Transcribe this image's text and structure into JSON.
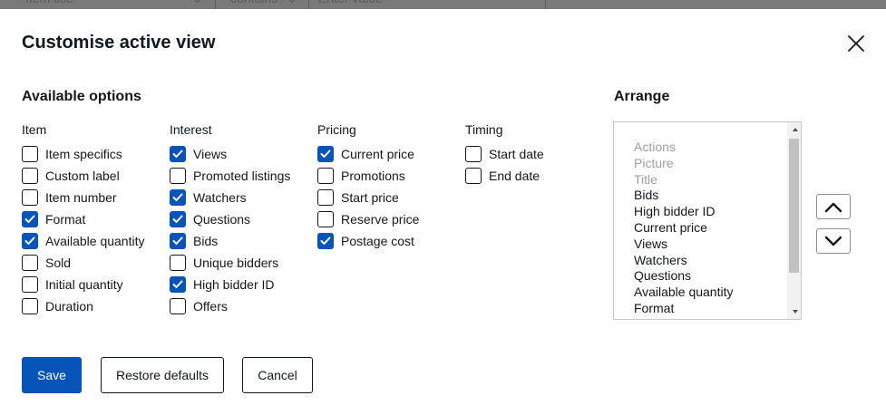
{
  "backdrop": {
    "field1": "Item title",
    "field2": "contains",
    "field3_placeholder": "Enter value"
  },
  "dialog": {
    "title": "Customise active view",
    "close_icon": "close-icon"
  },
  "available": {
    "title": "Available options",
    "columns": [
      {
        "heading": "Item",
        "options": [
          {
            "label": "Item specifics",
            "checked": false
          },
          {
            "label": "Custom label",
            "checked": false
          },
          {
            "label": "Item number",
            "checked": false
          },
          {
            "label": "Format",
            "checked": true
          },
          {
            "label": "Available quantity",
            "checked": true
          },
          {
            "label": "Sold",
            "checked": false
          },
          {
            "label": "Initial quantity",
            "checked": false
          },
          {
            "label": "Duration",
            "checked": false
          }
        ]
      },
      {
        "heading": "Interest",
        "options": [
          {
            "label": "Views",
            "checked": true
          },
          {
            "label": "Promoted listings",
            "checked": false
          },
          {
            "label": "Watchers",
            "checked": true
          },
          {
            "label": "Questions",
            "checked": true
          },
          {
            "label": "Bids",
            "checked": true
          },
          {
            "label": "Unique bidders",
            "checked": false
          },
          {
            "label": "High bidder ID",
            "checked": true
          },
          {
            "label": "Offers",
            "checked": false
          }
        ]
      },
      {
        "heading": "Pricing",
        "options": [
          {
            "label": "Current price",
            "checked": true
          },
          {
            "label": "Promotions",
            "checked": false
          },
          {
            "label": "Start price",
            "checked": false
          },
          {
            "label": "Reserve price",
            "checked": false
          },
          {
            "label": "Postage cost",
            "checked": true
          }
        ]
      },
      {
        "heading": "Timing",
        "options": [
          {
            "label": "Start date",
            "checked": false
          },
          {
            "label": "End date",
            "checked": false
          }
        ]
      }
    ]
  },
  "arrange": {
    "title": "Arrange",
    "items": [
      {
        "label": "Actions",
        "disabled": true
      },
      {
        "label": "Picture",
        "disabled": true
      },
      {
        "label": "Title",
        "disabled": true
      },
      {
        "label": "Bids",
        "disabled": false
      },
      {
        "label": "High bidder ID",
        "disabled": false
      },
      {
        "label": "Current price",
        "disabled": false
      },
      {
        "label": "Views",
        "disabled": false
      },
      {
        "label": "Watchers",
        "disabled": false
      },
      {
        "label": "Questions",
        "disabled": false
      },
      {
        "label": "Available quantity",
        "disabled": false
      },
      {
        "label": "Format",
        "disabled": false
      }
    ],
    "move_up_icon": "chevron-up-icon",
    "move_down_icon": "chevron-down-icon"
  },
  "footer": {
    "save_label": "Save",
    "restore_label": "Restore defaults",
    "cancel_label": "Cancel"
  },
  "colors": {
    "primary": "#0654ba",
    "text": "#111820",
    "disabled_text": "#a0a0a0",
    "overlay": "#7f7f7f"
  }
}
